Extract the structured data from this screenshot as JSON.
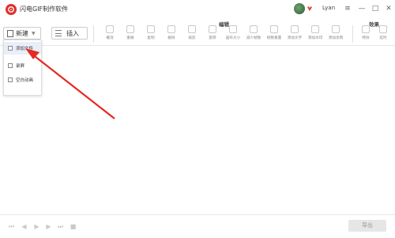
{
  "app": {
    "title": "闪电GIF制作软件",
    "logo_icon": "app-logo-icon",
    "brand_color": "#e0312b",
    "accent_color": "#e52a21"
  },
  "user": {
    "name": "Lyan"
  },
  "window_controls": [
    "≡",
    "—",
    "□",
    "✕"
  ],
  "toolbar": {
    "new_label": "新建",
    "insert_label": "插入",
    "edit_group_label": "编辑",
    "effects_group_label": "效果",
    "edit_tools": [
      {
        "label": "撤消",
        "icon": "undo-icon"
      },
      {
        "label": "重做",
        "icon": "redo-icon"
      },
      {
        "label": "复制",
        "icon": "copy-icon"
      },
      {
        "label": "删除",
        "icon": "delete-icon"
      },
      {
        "label": "裁剪",
        "icon": "crop-icon"
      },
      {
        "label": "旋转",
        "icon": "rotate-icon"
      },
      {
        "label": "画布大小",
        "icon": "canvas-size-icon"
      },
      {
        "label": "减少帧数",
        "icon": "reduce-frames-icon"
      },
      {
        "label": "帧数重置",
        "icon": "reset-frames-icon"
      },
      {
        "label": "添加文字",
        "icon": "add-text-icon"
      },
      {
        "label": "添加水印",
        "icon": "add-watermark-icon"
      },
      {
        "label": "添加涂鸦",
        "icon": "add-doodle-icon"
      }
    ],
    "effect_tools": [
      {
        "label": "特效",
        "icon": "effects-icon"
      },
      {
        "label": "延时",
        "icon": "delay-icon"
      }
    ]
  },
  "new_menu": {
    "items": [
      {
        "label": "添加文件",
        "icon": "add-file-icon",
        "active": true
      },
      {
        "label": "录屏",
        "icon": "record-screen-icon",
        "active": false
      },
      {
        "label": "空白动画",
        "icon": "blank-animation-icon",
        "active": false
      }
    ]
  },
  "footer": {
    "export_label": "导出",
    "controls": [
      "first-frame-icon",
      "prev-frame-icon",
      "play-icon",
      "next-frame-icon",
      "last-frame-icon",
      "stop-icon"
    ]
  }
}
